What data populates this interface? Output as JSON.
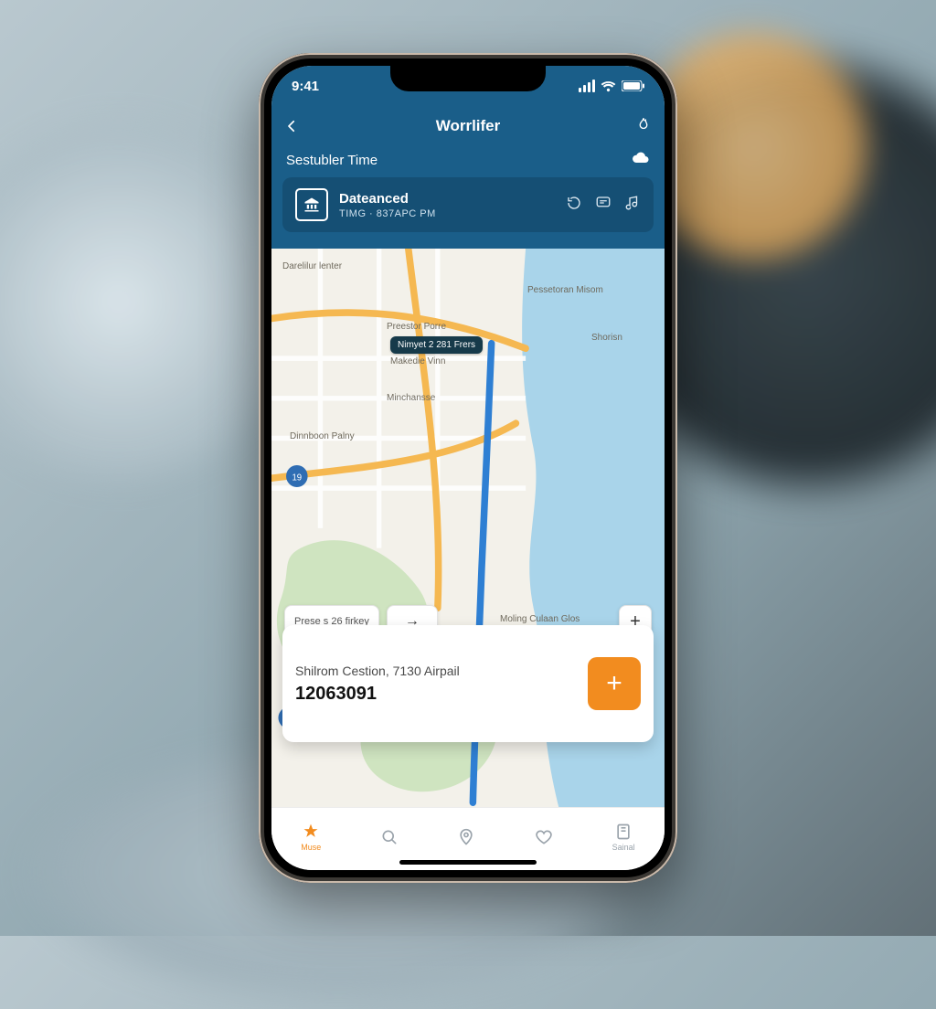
{
  "status": {
    "time": "9:41"
  },
  "header": {
    "title": "Worrlifer",
    "subtitle": "Sestubler Time",
    "card": {
      "title": "Dateanced",
      "subtitle": "TIMG · 837APC Pm"
    }
  },
  "map": {
    "labels": {
      "top_left": "Darelilur lenter",
      "point1": "Preestor Porre",
      "point2": "Makedie Vinn",
      "badge": "Nimyet 2 281 Frers",
      "left_mid": "Dinnboon Palny",
      "mid": "Minchansse",
      "right_top": "Pessetoran Misom",
      "right_shore": "Shorisn",
      "bottom_right": "Moling Culaan Glos"
    },
    "chip_text": "Prese s 26 firkey"
  },
  "destination": {
    "title": "Shilrom Cestion, 7130 Airpail",
    "number": "12063091"
  },
  "tabs": {
    "t1": "Muse",
    "t5": "Sainal"
  }
}
